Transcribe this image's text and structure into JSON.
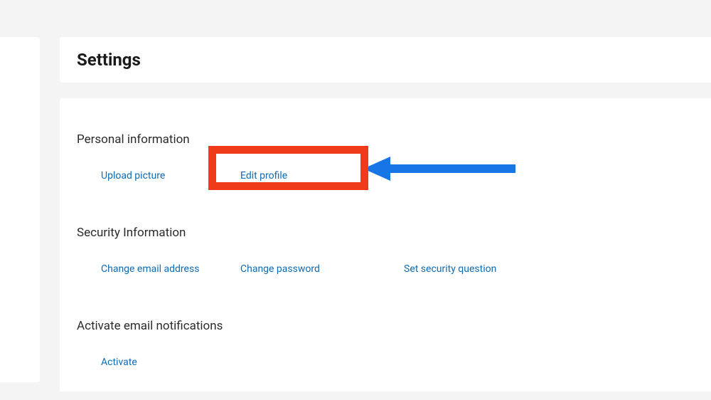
{
  "header": {
    "title": "Settings"
  },
  "sections": {
    "personal": {
      "title": "Personal information",
      "links": {
        "upload_picture": "Upload picture",
        "edit_profile": "Edit profile"
      }
    },
    "security": {
      "title": "Security Information",
      "links": {
        "change_email": "Change email address",
        "change_password": "Change password",
        "set_security_question": "Set security question"
      }
    },
    "notifications": {
      "title": "Activate email notifications",
      "links": {
        "activate": "Activate"
      }
    }
  },
  "annotation": {
    "highlight_target": "edit-profile-link",
    "highlight_color": "#ee3c1b",
    "arrow_color": "#1775e6"
  }
}
